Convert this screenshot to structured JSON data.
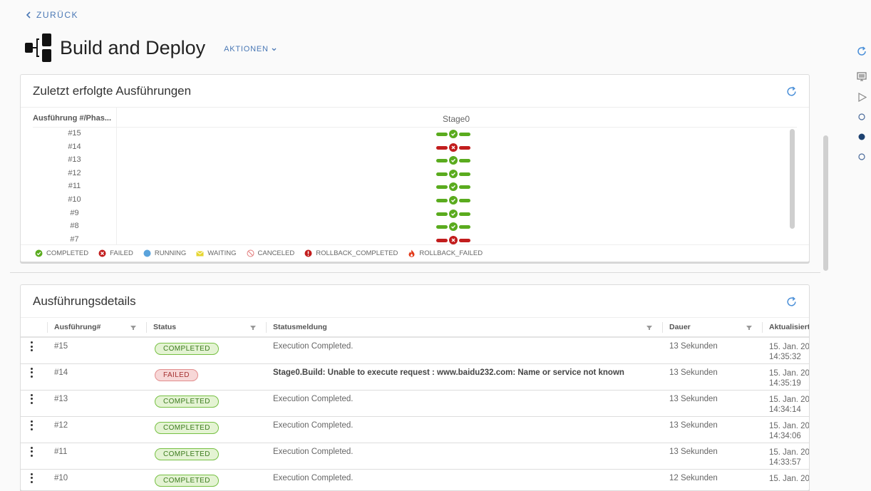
{
  "nav": {
    "back_label": "ZURÜCK"
  },
  "header": {
    "title": "Build and Deploy",
    "actions_label": "AKTIONEN"
  },
  "right_rail": [
    "refresh-icon",
    "monitor-icon",
    "play-icon",
    "circle-outline-icon",
    "circle-filled-icon",
    "circle-outline-icon"
  ],
  "recent": {
    "title": "Zuletzt erfolgte Ausführungen",
    "col_header": "Ausführung #/Phas...",
    "stage_header": "Stage0",
    "rows": [
      {
        "num": "#15",
        "status": "COMPLETED"
      },
      {
        "num": "#14",
        "status": "FAILED"
      },
      {
        "num": "#13",
        "status": "COMPLETED"
      },
      {
        "num": "#12",
        "status": "COMPLETED"
      },
      {
        "num": "#11",
        "status": "COMPLETED"
      },
      {
        "num": "#10",
        "status": "COMPLETED"
      },
      {
        "num": "#9",
        "status": "COMPLETED"
      },
      {
        "num": "#8",
        "status": "COMPLETED"
      },
      {
        "num": "#7",
        "status": "FAILED"
      }
    ],
    "legend": [
      {
        "label": "COMPLETED",
        "icon": "check-circle-icon"
      },
      {
        "label": "FAILED",
        "icon": "x-circle-icon"
      },
      {
        "label": "RUNNING",
        "icon": "running-dot-icon"
      },
      {
        "label": "WAITING",
        "icon": "envelope-icon"
      },
      {
        "label": "CANCELED",
        "icon": "ban-icon"
      },
      {
        "label": "ROLLBACK_COMPLETED",
        "icon": "exclamation-circle-icon"
      },
      {
        "label": "ROLLBACK_FAILED",
        "icon": "fire-icon"
      }
    ]
  },
  "details": {
    "title": "Ausführungsdetails",
    "columns": [
      "Ausführung#",
      "Status",
      "Statusmeldung",
      "Dauer",
      "Aktualisiert"
    ],
    "rows": [
      {
        "num": "#15",
        "status": "COMPLETED",
        "message": "Execution Completed.",
        "duration": "13 Sekunden",
        "date": "15. Jan. 20",
        "time": "14:35:32"
      },
      {
        "num": "#14",
        "status": "FAILED",
        "message": "Stage0.Build: Unable to execute request : www.baidu232.com: Name or service not known",
        "duration": "13 Sekunden",
        "date": "15. Jan. 20",
        "time": "14:35:19"
      },
      {
        "num": "#13",
        "status": "COMPLETED",
        "message": "Execution Completed.",
        "duration": "13 Sekunden",
        "date": "15. Jan. 20",
        "time": "14:34:14"
      },
      {
        "num": "#12",
        "status": "COMPLETED",
        "message": "Execution Completed.",
        "duration": "13 Sekunden",
        "date": "15. Jan. 20",
        "time": "14:34:06"
      },
      {
        "num": "#11",
        "status": "COMPLETED",
        "message": "Execution Completed.",
        "duration": "13 Sekunden",
        "date": "15. Jan. 20",
        "time": "14:33:57"
      },
      {
        "num": "#10",
        "status": "COMPLETED",
        "message": "Execution Completed.",
        "duration": "12 Sekunden",
        "date": "15. Jan. 20",
        "time": ""
      }
    ]
  },
  "colors": {
    "accent": "#4a78b5",
    "completed": "#5aab1e",
    "failed": "#c21d1d",
    "running": "#5aa3dc",
    "waiting": "#e6d630",
    "canceled": "#e27b7b",
    "rail_active": "#1d4170"
  }
}
